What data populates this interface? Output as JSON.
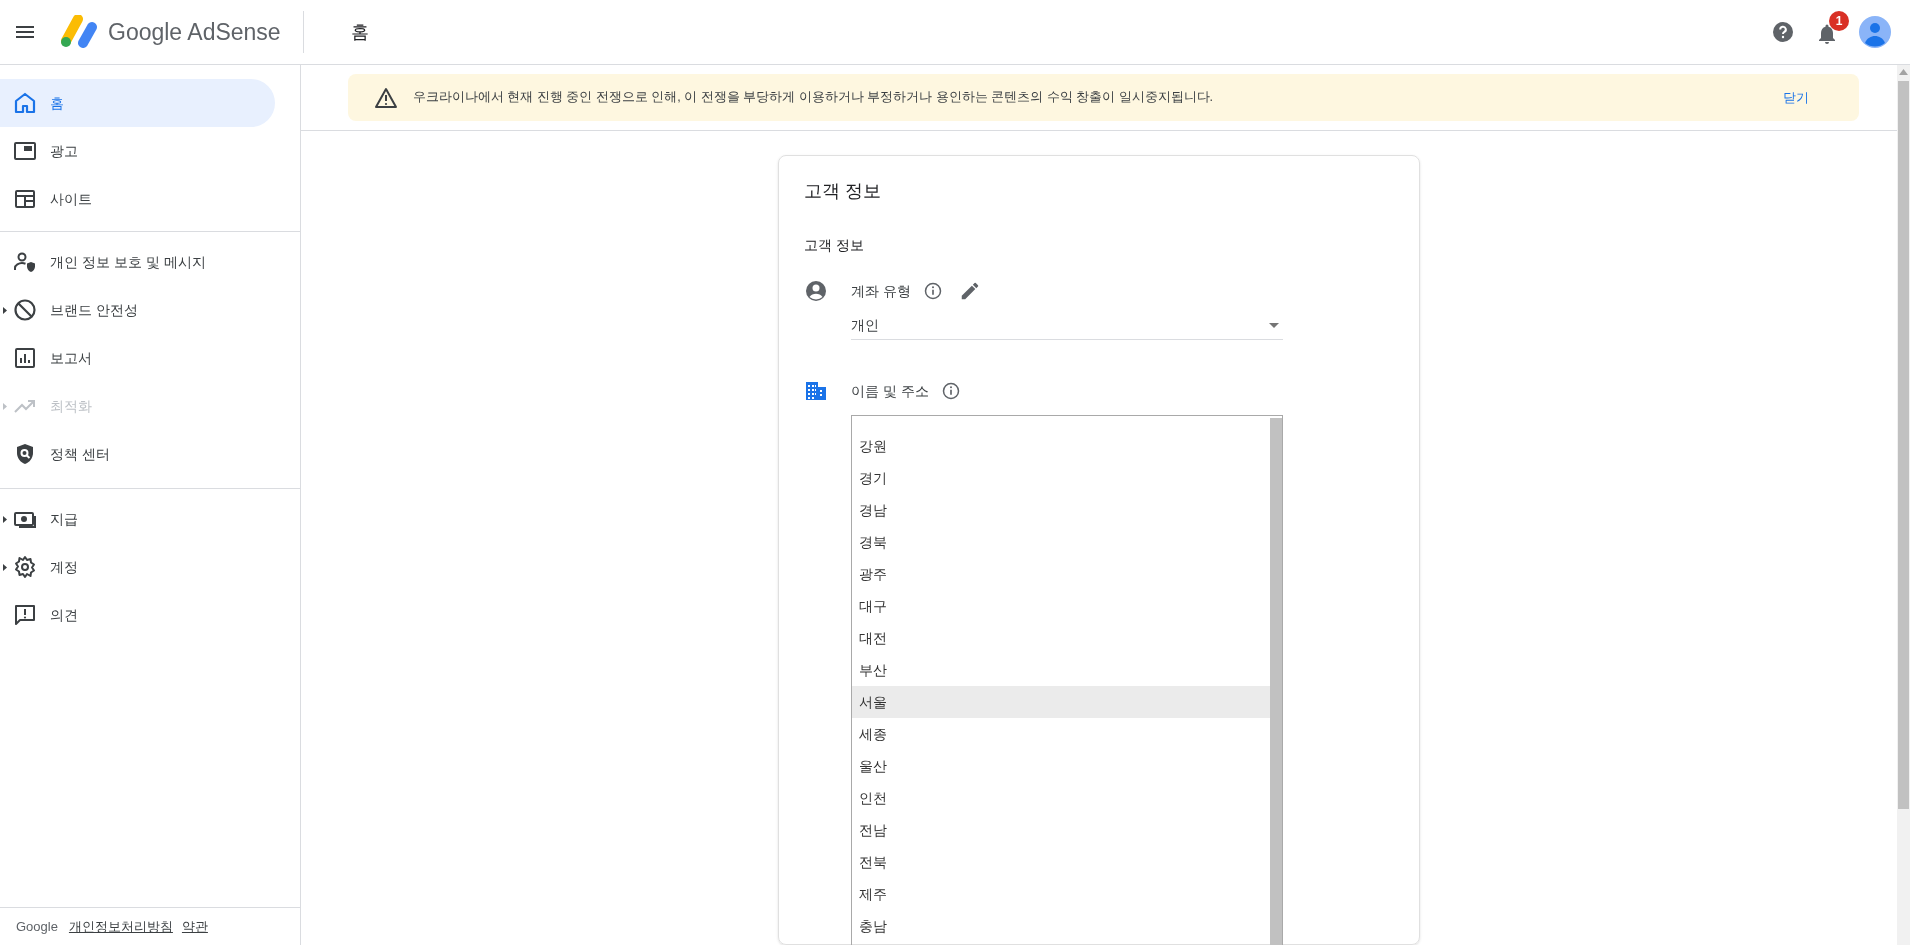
{
  "header": {
    "app_name": "Google AdSense",
    "page_title": "홈",
    "notification_count": "1"
  },
  "sidebar": {
    "sections": [
      [
        {
          "label": "홈",
          "selected": true,
          "disabled": false,
          "expandable": false
        },
        {
          "label": "광고",
          "selected": false,
          "disabled": false,
          "expandable": false
        },
        {
          "label": "사이트",
          "selected": false,
          "disabled": false,
          "expandable": false
        }
      ],
      [
        {
          "label": "개인 정보 보호 및 메시지",
          "selected": false,
          "disabled": false,
          "expandable": false
        },
        {
          "label": "브랜드 안전성",
          "selected": false,
          "disabled": false,
          "expandable": true
        },
        {
          "label": "보고서",
          "selected": false,
          "disabled": false,
          "expandable": false
        },
        {
          "label": "최적화",
          "selected": false,
          "disabled": true,
          "expandable": true
        },
        {
          "label": "정책 센터",
          "selected": false,
          "disabled": false,
          "expandable": false
        }
      ],
      [
        {
          "label": "지급",
          "selected": false,
          "disabled": false,
          "expandable": true
        },
        {
          "label": "계정",
          "selected": false,
          "disabled": false,
          "expandable": true
        },
        {
          "label": "의견",
          "selected": false,
          "disabled": false,
          "expandable": false
        }
      ]
    ],
    "footer": {
      "brand": "Google",
      "links": [
        "개인정보처리방침",
        "약관"
      ]
    }
  },
  "banner": {
    "message": "우크라이나에서 현재 진행 중인 전쟁으로 인해, 이 전쟁을 부당하게 이용하거나 부정하거나 용인하는 콘텐츠의 수익 창출이 일시중지됩니다.",
    "action": "닫기"
  },
  "card": {
    "title": "고객 정보",
    "section_title": "고객 정보",
    "fields": [
      {
        "kind": "select",
        "label": "계좌 유형",
        "value": "개인"
      },
      {
        "kind": "listbox",
        "label": "이름 및 주소",
        "options": [
          {
            "label": "강원",
            "selected": false
          },
          {
            "label": "경기",
            "selected": false
          },
          {
            "label": "경남",
            "selected": false
          },
          {
            "label": "경북",
            "selected": false
          },
          {
            "label": "광주",
            "selected": false
          },
          {
            "label": "대구",
            "selected": false
          },
          {
            "label": "대전",
            "selected": false
          },
          {
            "label": "부산",
            "selected": false
          },
          {
            "label": "서울",
            "selected": true
          },
          {
            "label": "세종",
            "selected": false
          },
          {
            "label": "울산",
            "selected": false
          },
          {
            "label": "인천",
            "selected": false
          },
          {
            "label": "전남",
            "selected": false
          },
          {
            "label": "전북",
            "selected": false
          },
          {
            "label": "제주",
            "selected": false
          },
          {
            "label": "충남",
            "selected": false
          }
        ]
      }
    ]
  }
}
